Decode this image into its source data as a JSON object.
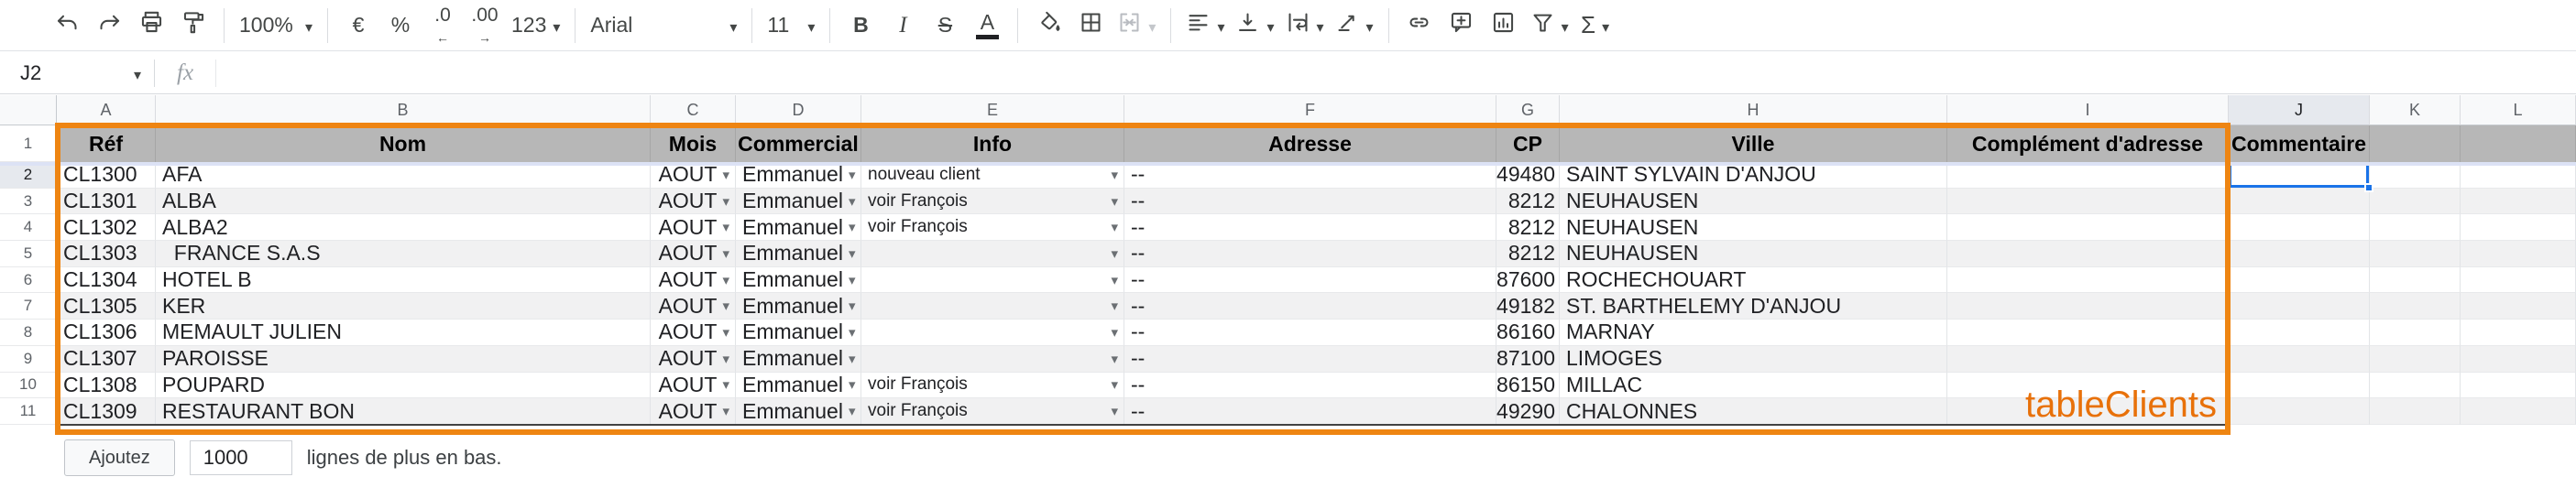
{
  "toolbar": {
    "zoom": "100%",
    "currency": "€",
    "percent": "%",
    "decrease_decimal": ".0",
    "increase_decimal": ".00",
    "more_formats": "123",
    "font": "Arial",
    "font_size": "11",
    "bold": "B",
    "italic": "I",
    "strikethrough": "S",
    "text_color": "A",
    "functions": "Σ"
  },
  "formula_bar": {
    "cell_reference": "J2",
    "fx_label": "fx"
  },
  "icons": {
    "dropdown_arrow": "▾"
  },
  "grid": {
    "column_letters": [
      "A",
      "B",
      "C",
      "D",
      "E",
      "F",
      "G",
      "H",
      "I",
      "J",
      "K",
      "L"
    ],
    "selected_column": "J",
    "selected_cell": "J2",
    "headers": [
      "Réf",
      "Nom",
      "Mois",
      "Commercial",
      "Info",
      "Adresse",
      "CP",
      "Ville",
      "Complément d'adresse",
      "Commentaire",
      "",
      ""
    ],
    "rows": [
      {
        "n": 2,
        "ref": "CL1300",
        "nom": "AFA",
        "mois": "AOUT",
        "commercial": "Emmanuel",
        "info": "nouveau client",
        "adresse": "--",
        "cp": "49480",
        "ville": "SAINT SYLVAIN D'ANJOU",
        "complement": "",
        "commentaire": ""
      },
      {
        "n": 3,
        "ref": "CL1301",
        "nom": "ALBA",
        "mois": "AOUT",
        "commercial": "Emmanuel",
        "info": "voir François",
        "adresse": "--",
        "cp": "8212",
        "ville": "NEUHAUSEN",
        "complement": "",
        "commentaire": ""
      },
      {
        "n": 4,
        "ref": "CL1302",
        "nom": "ALBA2",
        "mois": "AOUT",
        "commercial": "Emmanuel",
        "info": "voir François",
        "adresse": "--",
        "cp": "8212",
        "ville": "NEUHAUSEN",
        "complement": "",
        "commentaire": ""
      },
      {
        "n": 5,
        "ref": "CL1303",
        "nom": "  FRANCE S.A.S",
        "mois": "AOUT",
        "commercial": "Emmanuel",
        "info": "",
        "adresse": "--",
        "cp": "8212",
        "ville": "NEUHAUSEN",
        "complement": "",
        "commentaire": ""
      },
      {
        "n": 6,
        "ref": "CL1304",
        "nom": "HOTEL B",
        "mois": "AOUT",
        "commercial": "Emmanuel",
        "info": "",
        "adresse": "--",
        "cp": "87600",
        "ville": "ROCHECHOUART",
        "complement": "",
        "commentaire": ""
      },
      {
        "n": 7,
        "ref": "CL1305",
        "nom": "KER",
        "mois": "AOUT",
        "commercial": "Emmanuel",
        "info": "",
        "adresse": "--",
        "cp": "49182",
        "ville": "ST. BARTHELEMY D'ANJOU",
        "complement": "",
        "commentaire": ""
      },
      {
        "n": 8,
        "ref": "CL1306",
        "nom": "MEMAULT JULIEN",
        "mois": "AOUT",
        "commercial": "Emmanuel",
        "info": "",
        "adresse": "--",
        "cp": "86160",
        "ville": "MARNAY",
        "complement": "",
        "commentaire": ""
      },
      {
        "n": 9,
        "ref": "CL1307",
        "nom": "PAROISSE",
        "mois": "AOUT",
        "commercial": "Emmanuel",
        "info": "",
        "adresse": "--",
        "cp": "87100",
        "ville": "LIMOGES",
        "complement": "",
        "commentaire": ""
      },
      {
        "n": 10,
        "ref": "CL1308",
        "nom": "POUPARD",
        "mois": "AOUT",
        "commercial": "Emmanuel",
        "info": "voir François",
        "adresse": "--",
        "cp": "86150",
        "ville": "MILLAC",
        "complement": "",
        "commentaire": ""
      },
      {
        "n": 11,
        "ref": "CL1309",
        "nom": "RESTAURANT BON",
        "mois": "AOUT",
        "commercial": "Emmanuel",
        "info": "voir François",
        "adresse": "--",
        "cp": "49290",
        "ville": "CHALONNES",
        "complement": "",
        "commentaire": ""
      }
    ],
    "table_label": "tableClients"
  },
  "footer": {
    "add_button_label": "Ajoutez",
    "add_count": "1000",
    "add_suffix": "lignes de plus en bas."
  },
  "colors": {
    "table_border": "#ee8512",
    "table_label": "#e8710a",
    "selection": "#1a73e8",
    "header_fill": "#b7b7b7",
    "band_fill": "#f1f1f2"
  }
}
